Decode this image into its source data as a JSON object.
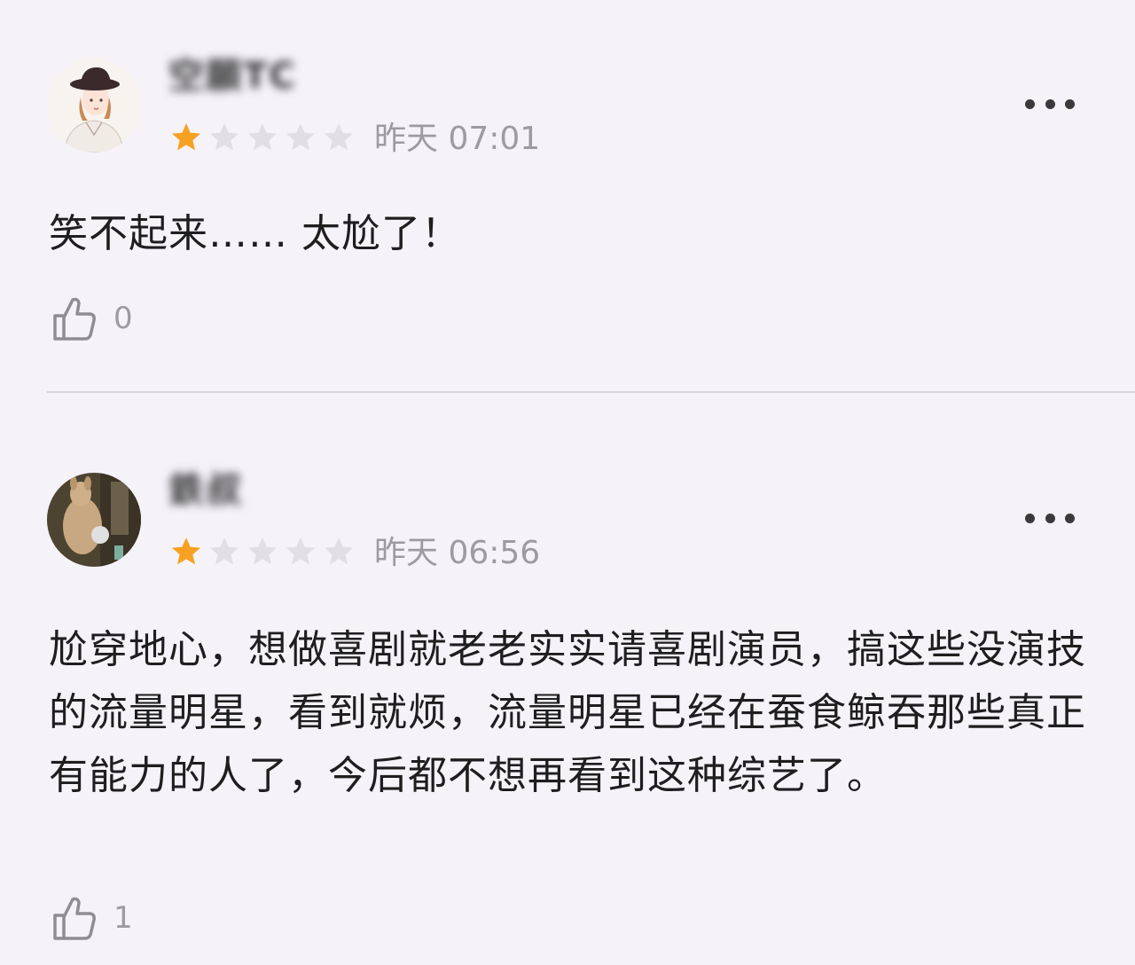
{
  "reviews": [
    {
      "username": "空願TC",
      "rating": 1,
      "max_rating": 5,
      "time": "昨天 07:01",
      "content": "笑不起来…… 太尬了！",
      "likes": "0",
      "avatar": "illustrated-girl-avatar"
    },
    {
      "username": "鉄叔",
      "rating": 1,
      "max_rating": 5,
      "time": "昨天 06:56",
      "content": "尬穿地心，想做喜剧就老老实实请喜剧演员，搞这些没演技的流量明星，看到就烦，流量明星已经在蚕食鲸吞那些真正有能力的人了，今后都不想再看到这种综艺了。",
      "likes": "1",
      "avatar": "kangaroo-photo-avatar"
    }
  ],
  "colors": {
    "star_filled": "#f7a123",
    "star_empty": "#e1dee5",
    "meta_text": "#9d9aa2",
    "background": "#f5f2f8"
  },
  "icons": {
    "more": "more-dots-icon",
    "like": "thumbs-up-icon"
  }
}
